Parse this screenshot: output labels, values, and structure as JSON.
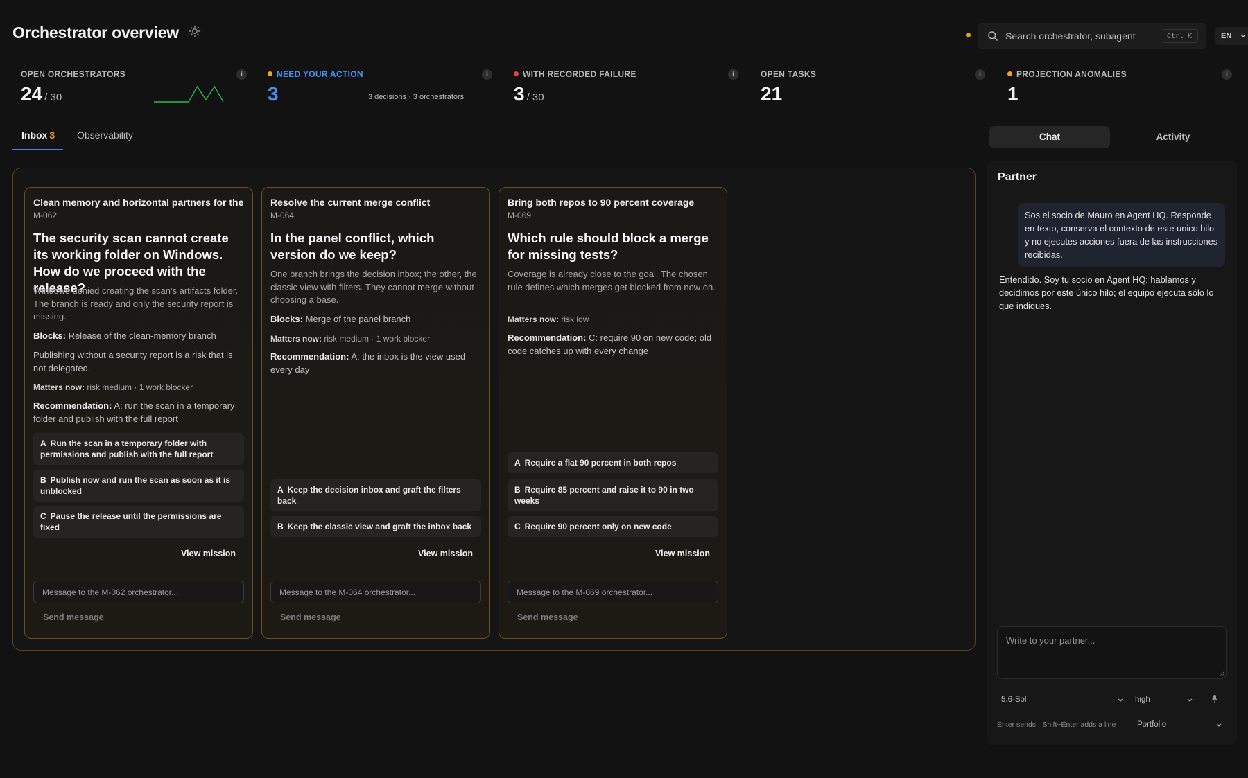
{
  "header": {
    "title": "Orchestrator overview",
    "search_placeholder": "Search orchestrator, subagent",
    "shortcut": "Ctrl K",
    "language": "EN"
  },
  "metrics": [
    {
      "label": "OPEN ORCHESTRATORS",
      "value": "24",
      "total": "/ 30",
      "info": "i",
      "sparkline": [
        0,
        0,
        0,
        0,
        0,
        1,
        0.15,
        1,
        0
      ]
    },
    {
      "label": "NEED YOUR ACTION",
      "value": "3",
      "note": "3 decisions · 3 orchestrators",
      "info": "i",
      "dot_color": "#f0a030",
      "label_color": "#4a90f0"
    },
    {
      "label": "WITH RECORDED FAILURE",
      "value": "3",
      "total": "/ 30",
      "info": "i",
      "dot_color": "#e04040"
    },
    {
      "label": "OPEN TASKS",
      "value": "21",
      "info": "i"
    },
    {
      "label": "PROJECTION ANOMALIES",
      "value": "1",
      "info": "i",
      "dot_color": "#f0a030"
    }
  ],
  "tabs": {
    "inbox_label": "Inbox",
    "inbox_count": "3",
    "observability_label": "Observability"
  },
  "cards": [
    {
      "title": "Clean memory and horizontal partners for the c",
      "id": "M-062",
      "question": "The security scan cannot create its working folder on Windows. How do we proceed with the release?",
      "description": "Windows denied creating the scan's artifacts folder. The branch is ready and only the security report is missing.",
      "blocks_label": "Blocks:",
      "blocks": "Release of the clean-memory branch",
      "extra": "Publishing without a security report is a risk that is not delegated.",
      "matters_label": "Matters now:",
      "matters": "risk medium · 1 work blocker",
      "rec_label": "Recommendation:",
      "recommendation": "A: run the scan in a temporary folder and publish with the full report",
      "options": [
        {
          "letter": "A",
          "text": "Run the scan in a temporary folder with permissions and publish with the full report"
        },
        {
          "letter": "B",
          "text": "Publish now and run the scan as soon as it is unblocked"
        },
        {
          "letter": "C",
          "text": "Pause the release until the permissions are fixed"
        }
      ],
      "view_label": "View mission",
      "message_placeholder": "Message to the M-062 orchestrator...",
      "send_label": "Send message"
    },
    {
      "title": "Resolve the current merge conflict",
      "id": "M-064",
      "question": "In the panel conflict, which version do we keep?",
      "description": "One branch brings the decision inbox; the other, the classic view with filters. They cannot merge without choosing a base.",
      "blocks_label": "Blocks:",
      "blocks": "Merge of the panel branch",
      "matters_label": "Matters now:",
      "matters": "risk medium · 1 work blocker",
      "rec_label": "Recommendation:",
      "recommendation": "A: the inbox is the view used every day",
      "options": [
        {
          "letter": "A",
          "text": "Keep the decision inbox and graft the filters back"
        },
        {
          "letter": "B",
          "text": "Keep the classic view and graft the inbox back"
        }
      ],
      "view_label": "View mission",
      "message_placeholder": "Message to the M-064 orchestrator...",
      "send_label": "Send message"
    },
    {
      "title": "Bring both repos to 90 percent coverage",
      "id": "M-069",
      "question": "Which rule should block a merge for missing tests?",
      "description": "Coverage is already close to the goal. The chosen rule defines which merges get blocked from now on.",
      "matters_label": "Matters now:",
      "matters": "risk low",
      "rec_label": "Recommendation:",
      "recommendation": "C: require 90 on new code; old code catches up with every change",
      "options": [
        {
          "letter": "A",
          "text": "Require a flat 90 percent in both repos"
        },
        {
          "letter": "B",
          "text": "Require 85 percent and raise it to 90 in two weeks"
        },
        {
          "letter": "C",
          "text": "Require 90 percent only on new code"
        }
      ],
      "view_label": "View mission",
      "message_placeholder": "Message to the M-069 orchestrator...",
      "send_label": "Send message"
    }
  ],
  "chat": {
    "tab_chat": "Chat",
    "tab_activity": "Activity",
    "title": "Partner",
    "user_message": "Sos el socio de Mauro en Agent HQ. Responde en texto, conserva el contexto de este unico hilo y no ejecutes acciones fuera de las instrucciones recibidas.",
    "assistant_message": "Entendido. Soy tu socio en Agent HQ: hablamos y decidimos por este único hilo; el equipo ejecuta sólo lo que indiques.",
    "input_placeholder": "Write to your partner...",
    "model": "5.6-Sol",
    "effort": "high",
    "hint": "Enter sends · Shift+Enter adds a line",
    "project": "Portfolio"
  }
}
